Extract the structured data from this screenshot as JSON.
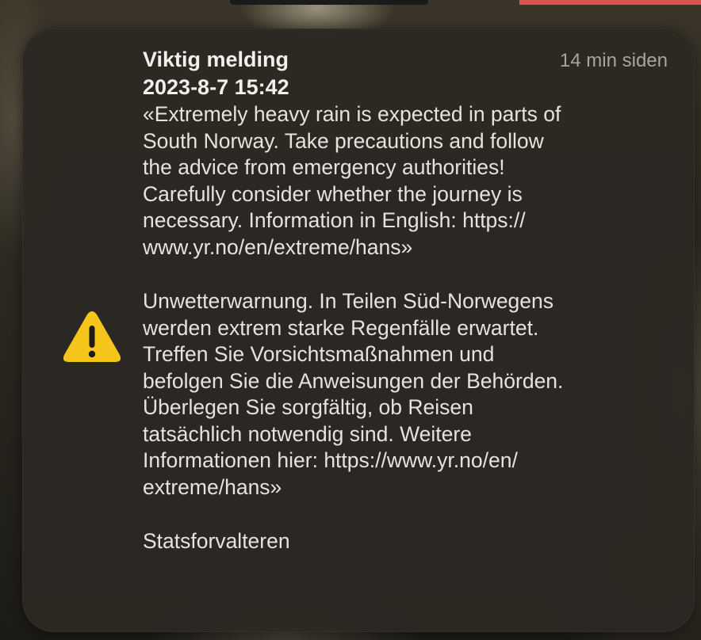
{
  "notification": {
    "icon": "warning-triangle-icon",
    "title": "Viktig melding",
    "time_ago": "14 min siden",
    "date": "2023-8-7 15:42",
    "message_en": "«Extremely heavy rain is expected in parts of\nSouth Norway. Take precautions and follow\nthe advice from emergency authorities!\nCarefully consider whether the journey is\nnecessary. Information in English: https://\nwww.yr.no/en/extreme/hans»",
    "message_de": "Unwetterwarnung. In Teilen Süd-Norwegens\nwerden extrem starke Regenfälle erwartet.\nTreffen Sie Vorsichtsmaßnahmen und\nbefolgen Sie die Anweisungen der Behörden.\nÜberlegen Sie sorgfältig, ob Reisen\ntatsächlich notwendig sind. Weitere\nInformationen hier: https://www.yr.no/en/\nextreme/hans»",
    "sender": "Statsforvalteren"
  },
  "colors": {
    "card_background": "#2c2822",
    "warning_yellow": "#f5c51b",
    "text_primary": "#f2f0ec",
    "text_secondary": "#a9a59d"
  }
}
